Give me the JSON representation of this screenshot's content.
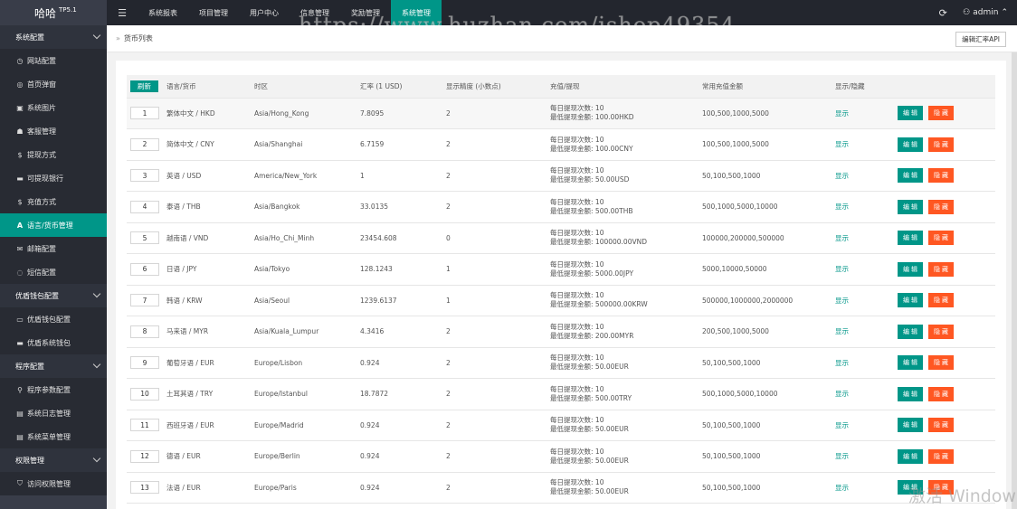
{
  "app": {
    "logo": "哈哈",
    "version": "TP5.1",
    "menu_toggle": "☰"
  },
  "topnav": [
    {
      "label": "系统报表",
      "active": false
    },
    {
      "label": "项目管理",
      "active": false
    },
    {
      "label": "用户中心",
      "active": false
    },
    {
      "label": "信息管理",
      "active": false
    },
    {
      "label": "奖励管理",
      "active": false
    },
    {
      "label": "系统管理",
      "active": true
    }
  ],
  "user": {
    "name": "admin"
  },
  "watermark": "https://www.huzhan.com/ishop49354",
  "sidebar": [
    {
      "type": "group",
      "label": "系统配置",
      "icon": ""
    },
    {
      "type": "item",
      "label": "网站配置",
      "icon": "◷"
    },
    {
      "type": "item",
      "label": "首页弹窗",
      "icon": "◎"
    },
    {
      "type": "item",
      "label": "系统图片",
      "icon": "▣"
    },
    {
      "type": "item",
      "label": "客服管理",
      "icon": "☗"
    },
    {
      "type": "item",
      "label": "提现方式",
      "icon": "$"
    },
    {
      "type": "item",
      "label": "可提现银行",
      "icon": "▬"
    },
    {
      "type": "item",
      "label": "充值方式",
      "icon": "$"
    },
    {
      "type": "item",
      "label": "语言/货币管理",
      "icon": "A",
      "active": true
    },
    {
      "type": "item",
      "label": "邮箱配置",
      "icon": "✉"
    },
    {
      "type": "item",
      "label": "短信配置",
      "icon": "◌"
    },
    {
      "type": "group",
      "label": "优盾钱包配置",
      "icon": ""
    },
    {
      "type": "item",
      "label": "优盾钱包配置",
      "icon": "▭"
    },
    {
      "type": "item",
      "label": "优盾系统钱包",
      "icon": "▬"
    },
    {
      "type": "group",
      "label": "程序配置",
      "icon": ""
    },
    {
      "type": "item",
      "label": "程序参数配置",
      "icon": "⚲"
    },
    {
      "type": "item",
      "label": "系统日志管理",
      "icon": "▤"
    },
    {
      "type": "item",
      "label": "系统菜单管理",
      "icon": "▤"
    },
    {
      "type": "group",
      "label": "权限管理",
      "icon": ""
    },
    {
      "type": "item",
      "label": "访问权限管理",
      "icon": "⛉"
    }
  ],
  "breadcrumb": {
    "arrows": "»",
    "current": "货币列表"
  },
  "api_button": "编辑汇率API",
  "table": {
    "refresh_label": "刷新",
    "headers": [
      "语言/货币",
      "时区",
      "汇率 (1 USD)",
      "显示精度 (小数点)",
      "充值/提现",
      "常用充值金额",
      "显示/隐藏"
    ],
    "recharge_label_1": "每日提现次数: ",
    "recharge_label_2": "最低提现金额: ",
    "edit_label": "编 辑",
    "hide_label": "隐 藏",
    "rows": [
      {
        "sort": "1",
        "lang": "繁体中文 / HKD",
        "tz": "Asia/Hong_Kong",
        "rate": "7.8095",
        "precision": "2",
        "times": "10",
        "min": "100.00HKD",
        "amounts": "100,500,1000,5000",
        "status": "显示"
      },
      {
        "sort": "2",
        "lang": "简体中文 / CNY",
        "tz": "Asia/Shanghai",
        "rate": "6.7159",
        "precision": "2",
        "times": "10",
        "min": "100.00CNY",
        "amounts": "100,500,1000,5000",
        "status": "显示"
      },
      {
        "sort": "3",
        "lang": "英语 / USD",
        "tz": "America/New_York",
        "rate": "1",
        "precision": "2",
        "times": "10",
        "min": "50.00USD",
        "amounts": "50,100,500,1000",
        "status": "显示"
      },
      {
        "sort": "4",
        "lang": "泰语 / THB",
        "tz": "Asia/Bangkok",
        "rate": "33.0135",
        "precision": "2",
        "times": "10",
        "min": "500.00THB",
        "amounts": "500,1000,5000,10000",
        "status": "显示"
      },
      {
        "sort": "5",
        "lang": "越南语 / VND",
        "tz": "Asia/Ho_Chi_Minh",
        "rate": "23454.608",
        "precision": "0",
        "times": "10",
        "min": "100000.00VND",
        "amounts": "100000,200000,500000",
        "status": "显示"
      },
      {
        "sort": "6",
        "lang": "日语 / JPY",
        "tz": "Asia/Tokyo",
        "rate": "128.1243",
        "precision": "1",
        "times": "10",
        "min": "5000.00JPY",
        "amounts": "5000,10000,50000",
        "status": "显示"
      },
      {
        "sort": "7",
        "lang": "韩语 / KRW",
        "tz": "Asia/Seoul",
        "rate": "1239.6137",
        "precision": "1",
        "times": "10",
        "min": "500000.00KRW",
        "amounts": "500000,1000000,2000000",
        "status": "显示"
      },
      {
        "sort": "8",
        "lang": "马来语 / MYR",
        "tz": "Asia/Kuala_Lumpur",
        "rate": "4.3416",
        "precision": "2",
        "times": "10",
        "min": "200.00MYR",
        "amounts": "200,500,1000,5000",
        "status": "显示"
      },
      {
        "sort": "9",
        "lang": "葡萄牙语 / EUR",
        "tz": "Europe/Lisbon",
        "rate": "0.924",
        "precision": "2",
        "times": "10",
        "min": "50.00EUR",
        "amounts": "50,100,500,1000",
        "status": "显示"
      },
      {
        "sort": "10",
        "lang": "土耳其语 / TRY",
        "tz": "Europe/Istanbul",
        "rate": "18.7872",
        "precision": "2",
        "times": "10",
        "min": "500.00TRY",
        "amounts": "500,1000,5000,10000",
        "status": "显示"
      },
      {
        "sort": "11",
        "lang": "西班牙语 / EUR",
        "tz": "Europe/Madrid",
        "rate": "0.924",
        "precision": "2",
        "times": "10",
        "min": "50.00EUR",
        "amounts": "50,100,500,1000",
        "status": "显示"
      },
      {
        "sort": "12",
        "lang": "德语 / EUR",
        "tz": "Europe/Berlin",
        "rate": "0.924",
        "precision": "2",
        "times": "10",
        "min": "50.00EUR",
        "amounts": "50,100,500,1000",
        "status": "显示"
      },
      {
        "sort": "13",
        "lang": "法语 / EUR",
        "tz": "Europe/Paris",
        "rate": "0.924",
        "precision": "2",
        "times": "10",
        "min": "50.00EUR",
        "amounts": "50,100,500,1000",
        "status": "显示"
      }
    ]
  },
  "os_watermark": "激活 Windows",
  "colors": {
    "accent": "#009688",
    "danger": "#ff5722",
    "sidebar": "#393d49",
    "topbar": "#23262e"
  }
}
